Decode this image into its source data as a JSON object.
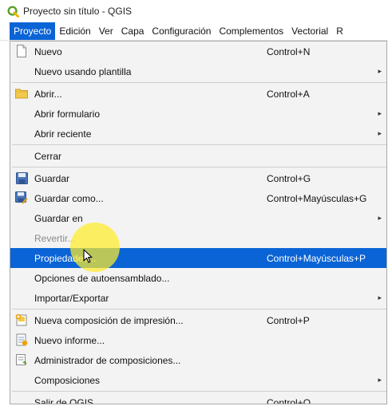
{
  "window": {
    "title": "Proyecto sin título - QGIS",
    "icon": "qgis-logo-icon"
  },
  "menubar": [
    {
      "label": "Proyecto",
      "active": true
    },
    {
      "label": "Edición"
    },
    {
      "label": "Ver"
    },
    {
      "label": "Capa"
    },
    {
      "label": "Configuración"
    },
    {
      "label": "Complementos"
    },
    {
      "label": "Vectorial"
    },
    {
      "label": "R"
    }
  ],
  "menu": {
    "items": [
      {
        "label": "Nuevo",
        "shortcut": "Control+N",
        "icon": "new-file-icon"
      },
      {
        "label": "Nuevo usando plantilla",
        "submenu": true
      },
      {
        "sep": true
      },
      {
        "label": "Abrir...",
        "shortcut": "Control+A",
        "icon": "folder-icon"
      },
      {
        "label": "Abrir formulario",
        "submenu": true
      },
      {
        "label": "Abrir reciente",
        "submenu": true
      },
      {
        "sep": true
      },
      {
        "label": "Cerrar"
      },
      {
        "sep": true
      },
      {
        "label": "Guardar",
        "shortcut": "Control+G",
        "icon": "save-icon"
      },
      {
        "label": "Guardar como...",
        "shortcut": "Control+Mayúsculas+G",
        "icon": "save-as-icon"
      },
      {
        "label": "Guardar en",
        "submenu": true
      },
      {
        "label": "Revertir...",
        "disabled": true
      },
      {
        "label": "Propiedades...",
        "shortcut": "Control+Mayúsculas+P",
        "selected": true
      },
      {
        "label": "Opciones de autoensamblado..."
      },
      {
        "label": "Importar/Exportar",
        "submenu": true
      },
      {
        "sep": true
      },
      {
        "label": "Nueva composición de impresión...",
        "shortcut": "Control+P",
        "icon": "new-print-layout-icon"
      },
      {
        "label": "Nuevo informe...",
        "icon": "new-report-icon"
      },
      {
        "label": "Administrador de composiciones...",
        "icon": "layout-manager-icon"
      },
      {
        "label": "Composiciones",
        "submenu": true
      },
      {
        "sep": true
      },
      {
        "label": "Salir de QGIS",
        "shortcut": "Control+Q"
      }
    ],
    "submenu_arrow": "▸"
  },
  "colors": {
    "highlight": "#0a64d6",
    "menu_bg": "#f3f3f3",
    "cursor_halo": "#ffec28"
  }
}
